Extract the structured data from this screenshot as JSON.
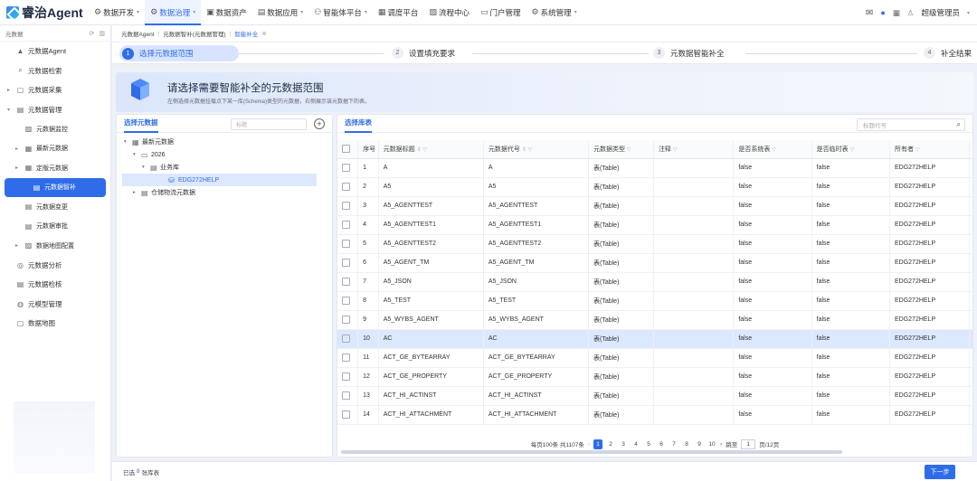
{
  "app": {
    "title": "睿治Agent"
  },
  "nav": [
    {
      "label": "数据开发",
      "icon": "⚙",
      "caret": true
    },
    {
      "label": "数据治理",
      "icon": "⚙",
      "caret": true,
      "active": true
    },
    {
      "label": "数据资产",
      "icon": "▣",
      "caret": false
    },
    {
      "label": "数据应用",
      "icon": "▤",
      "caret": true
    },
    {
      "label": "智能体平台",
      "icon": "⚇",
      "caret": true
    },
    {
      "label": "调度平台",
      "icon": "▦",
      "caret": false
    },
    {
      "label": "流程中心",
      "icon": "▧",
      "caret": false
    },
    {
      "label": "门户管理",
      "icon": "▭",
      "caret": false
    },
    {
      "label": "系统管理",
      "icon": "⚙",
      "caret": true
    }
  ],
  "topright": {
    "user": "超级管理员"
  },
  "sidebar": {
    "header": "元数据",
    "items": [
      {
        "label": "元数据Agent",
        "icon": "▲",
        "arrow": ""
      },
      {
        "label": "元数据检索",
        "icon": "⌕",
        "arrow": ""
      },
      {
        "label": "元数据采集",
        "icon": "▢",
        "arrow": "▸"
      },
      {
        "label": "元数据管理",
        "icon": "▤",
        "arrow": "▾"
      },
      {
        "label": "元数据监控",
        "icon": "▨",
        "arrow": "",
        "sub": true
      },
      {
        "label": "最新元数据",
        "icon": "▦",
        "arrow": "▸",
        "sub": true
      },
      {
        "label": "定版元数据",
        "icon": "▦",
        "arrow": "▸",
        "sub": true
      },
      {
        "label": "元数据智补",
        "icon": "▤",
        "arrow": "",
        "sub": true,
        "active": true
      },
      {
        "label": "元数据变更",
        "icon": "▤",
        "arrow": "",
        "sub": true
      },
      {
        "label": "元数据审批",
        "icon": "▤",
        "arrow": "",
        "sub": true
      },
      {
        "label": "数据地图配置",
        "icon": "▨",
        "arrow": "▸",
        "sub": true
      },
      {
        "label": "元数据分析",
        "icon": "◎",
        "arrow": ""
      },
      {
        "label": "元数据检核",
        "icon": "▤",
        "arrow": ""
      },
      {
        "label": "元模型管理",
        "icon": "◍",
        "arrow": ""
      },
      {
        "label": "数据地图",
        "icon": "▢",
        "arrow": ""
      }
    ]
  },
  "breadcrumb": {
    "c1": "元数据Agent",
    "c2": "元数据智补(元数据管理)",
    "tag": "智能补全"
  },
  "steps": [
    {
      "num": "1",
      "label": "选择元数据范围"
    },
    {
      "num": "2",
      "label": "设置填充要求"
    },
    {
      "num": "3",
      "label": "元数据智能补全"
    },
    {
      "num": "4",
      "label": "补全结果"
    }
  ],
  "panel": {
    "title": "请选择需要智能补全的元数据范围",
    "subtitle": "左侧选择元数据挂载点下某一库(Schema)类型的元数据，右侧展示该元数据下的表。"
  },
  "left": {
    "tab": "选择元数据",
    "search_placeholder": "标题",
    "tree": [
      {
        "label": "最新元数据",
        "icon": "▦",
        "tw": "▾",
        "indent": 0
      },
      {
        "label": "2026",
        "icon": "▭",
        "tw": "▾",
        "indent": 1
      },
      {
        "label": "业务库",
        "icon": "▤",
        "tw": "▾",
        "indent": 2
      },
      {
        "label": "EDG272HELP",
        "icon": "⛁",
        "tw": "",
        "indent": 4,
        "selected": true
      },
      {
        "label": "仓储物流元数据",
        "icon": "▤",
        "tw": "▸",
        "indent": 1
      }
    ]
  },
  "right": {
    "tab": "选择库表",
    "search_placeholder": "标题代号",
    "columns": [
      "序号",
      "元数据标题",
      "元数据代号",
      "元数据类型",
      "注释",
      "是否系统表",
      "是否临时表",
      "所有者",
      "更"
    ],
    "rows": [
      [
        "1",
        "A",
        "A",
        "表(Table)",
        "",
        "false",
        "false",
        "EDG272HELP"
      ],
      [
        "2",
        "A5",
        "A5",
        "表(Table)",
        "",
        "false",
        "false",
        "EDG272HELP"
      ],
      [
        "3",
        "A5_AGENTTEST",
        "A5_AGENTTEST",
        "表(Table)",
        "",
        "false",
        "false",
        "EDG272HELP"
      ],
      [
        "4",
        "A5_AGENTTEST1",
        "A5_AGENTTEST1",
        "表(Table)",
        "",
        "false",
        "false",
        "EDG272HELP"
      ],
      [
        "5",
        "A5_AGENTTEST2",
        "A5_AGENTTEST2",
        "表(Table)",
        "",
        "false",
        "false",
        "EDG272HELP"
      ],
      [
        "6",
        "A5_AGENT_TM",
        "A5_AGENT_TM",
        "表(Table)",
        "",
        "false",
        "false",
        "EDG272HELP"
      ],
      [
        "7",
        "A5_JSON",
        "A5_JSON",
        "表(Table)",
        "",
        "false",
        "false",
        "EDG272HELP"
      ],
      [
        "8",
        "A5_TEST",
        "A5_TEST",
        "表(Table)",
        "",
        "false",
        "false",
        "EDG272HELP"
      ],
      [
        "9",
        "A5_WYBS_AGENT",
        "A5_WYBS_AGENT",
        "表(Table)",
        "",
        "false",
        "false",
        "EDG272HELP"
      ],
      [
        "10",
        "AC",
        "AC",
        "表(Table)",
        "",
        "false",
        "false",
        "EDG272HELP"
      ],
      [
        "11",
        "ACT_GE_BYTEARRAY",
        "ACT_GE_BYTEARRAY",
        "表(Table)",
        "",
        "false",
        "false",
        "EDG272HELP"
      ],
      [
        "12",
        "ACT_GE_PROPERTY",
        "ACT_GE_PROPERTY",
        "表(Table)",
        "",
        "false",
        "false",
        "EDG272HELP"
      ],
      [
        "13",
        "ACT_HI_ACTINST",
        "ACT_HI_ACTINST",
        "表(Table)",
        "",
        "false",
        "false",
        "EDG272HELP"
      ],
      [
        "14",
        "ACT_HI_ATTACHMENT",
        "ACT_HI_ATTACHMENT",
        "表(Table)",
        "",
        "false",
        "false",
        "EDG272HELP"
      ]
    ],
    "highlight_row": 9
  },
  "pager": {
    "info": "每页100条 共1107条",
    "pages": [
      "1",
      "2",
      "3",
      "4",
      "5",
      "6",
      "7",
      "8",
      "9",
      "10"
    ],
    "current": "1",
    "goto_label": "跳至",
    "goto_value": "1",
    "total": "页/12页"
  },
  "bottom": {
    "prefix": "已选",
    "count": "8",
    "suffix": "张库表",
    "next": "下一步"
  }
}
